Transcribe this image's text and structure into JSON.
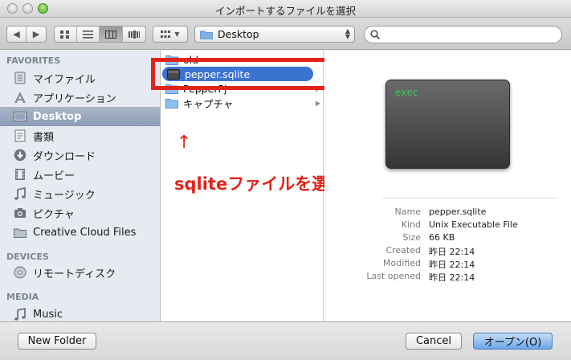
{
  "window": {
    "title": "インポートするファイルを選択"
  },
  "toolbar": {
    "back_icon": "chevron-left-icon",
    "forward_icon": "chevron-right-icon",
    "view_modes": [
      "icon-view",
      "list-view",
      "column-view",
      "coverflow-view"
    ],
    "selected_view": "column-view",
    "arrange_icon": "arrange-grid-icon",
    "location": "Desktop",
    "search": {
      "value": "",
      "placeholder": ""
    }
  },
  "sidebar": {
    "favorites_header": "FAVORITES",
    "favorites": [
      {
        "label": "マイファイル",
        "icon": "all-files-icon"
      },
      {
        "label": "アプリケーション",
        "icon": "applications-icon"
      },
      {
        "label": "Desktop",
        "icon": "desktop-icon",
        "selected": true
      },
      {
        "label": "書類",
        "icon": "documents-icon"
      },
      {
        "label": "ダウンロード",
        "icon": "downloads-icon"
      },
      {
        "label": "ムービー",
        "icon": "movies-icon"
      },
      {
        "label": "ミュージック",
        "icon": "music-icon"
      },
      {
        "label": "ピクチャ",
        "icon": "pictures-icon"
      },
      {
        "label": "Creative Cloud Files",
        "icon": "folder-icon"
      }
    ],
    "devices_header": "DEVICES",
    "devices": [
      {
        "label": "リモートディスク",
        "icon": "remote-disc-icon"
      }
    ],
    "media_header": "MEDIA",
    "media": [
      {
        "label": "Music",
        "icon": "music-icon"
      }
    ]
  },
  "files": [
    {
      "name": "old",
      "type": "folder",
      "has_children": true
    },
    {
      "name": "pepper.sqlite",
      "type": "file",
      "selected": true
    },
    {
      "name": "PepperPj",
      "type": "folder",
      "has_children": true
    },
    {
      "name": "キャプチャ",
      "type": "folder",
      "has_children": true
    }
  ],
  "annotation": {
    "arrow": "↑",
    "text": "sqliteファイルを選択",
    "color": "#e2231a"
  },
  "preview": {
    "thumbnail_text": "exec",
    "info": [
      {
        "key": "Name",
        "value": "pepper.sqlite"
      },
      {
        "key": "Kind",
        "value": "Unix Executable File"
      },
      {
        "key": "Size",
        "value": "66 KB"
      },
      {
        "key": "Created",
        "value": "昨日 22:14"
      },
      {
        "key": "Modified",
        "value": "昨日 22:14"
      },
      {
        "key": "Last opened",
        "value": "昨日 22:14"
      }
    ]
  },
  "footer": {
    "new_folder": "New Folder",
    "cancel": "Cancel",
    "open": "オープン(O)"
  },
  "colors": {
    "selection": "#3b73d1",
    "sidebar_selection": "#9aa8be",
    "accent_button": "#6aa7e8",
    "annotation": "#e2231a"
  }
}
